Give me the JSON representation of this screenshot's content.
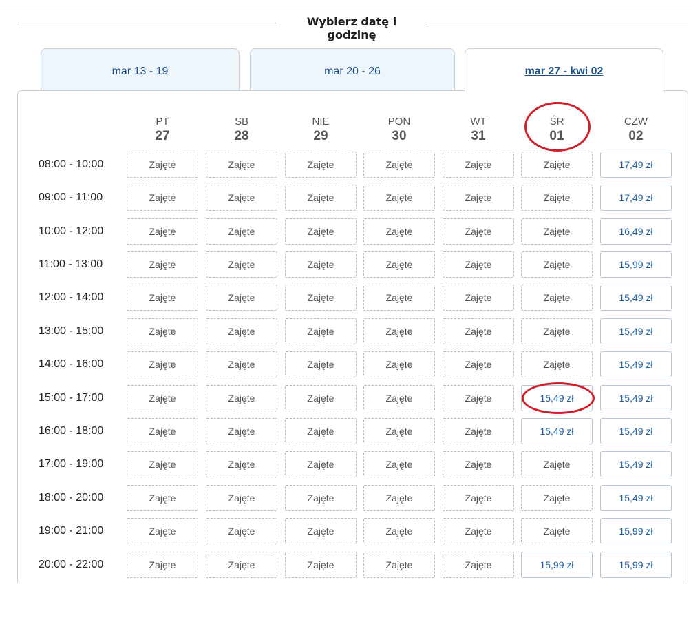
{
  "header": {
    "title": "Wybierz datę i godzinę"
  },
  "tabs": [
    {
      "label": "mar 13 - 19",
      "active": false
    },
    {
      "label": "mar 20 - 26",
      "active": false
    },
    {
      "label": "mar 27 - kwi 02",
      "active": true
    }
  ],
  "days": [
    {
      "name": "PT",
      "num": "27"
    },
    {
      "name": "SB",
      "num": "28"
    },
    {
      "name": "NIE",
      "num": "29"
    },
    {
      "name": "PON",
      "num": "30"
    },
    {
      "name": "WT",
      "num": "31"
    },
    {
      "name": "ŚR",
      "num": "01"
    },
    {
      "name": "CZW",
      "num": "02"
    }
  ],
  "taken_label": "Zajęte",
  "rows": [
    {
      "time": "08:00 - 10:00",
      "cells": [
        "Zajęte",
        "Zajęte",
        "Zajęte",
        "Zajęte",
        "Zajęte",
        "Zajęte",
        "17,49 zł"
      ]
    },
    {
      "time": "09:00 - 11:00",
      "cells": [
        "Zajęte",
        "Zajęte",
        "Zajęte",
        "Zajęte",
        "Zajęte",
        "Zajęte",
        "17,49 zł"
      ]
    },
    {
      "time": "10:00 - 12:00",
      "cells": [
        "Zajęte",
        "Zajęte",
        "Zajęte",
        "Zajęte",
        "Zajęte",
        "Zajęte",
        "16,49 zł"
      ]
    },
    {
      "time": "11:00 - 13:00",
      "cells": [
        "Zajęte",
        "Zajęte",
        "Zajęte",
        "Zajęte",
        "Zajęte",
        "Zajęte",
        "15,99 zł"
      ]
    },
    {
      "time": "12:00 - 14:00",
      "cells": [
        "Zajęte",
        "Zajęte",
        "Zajęte",
        "Zajęte",
        "Zajęte",
        "Zajęte",
        "15,49 zł"
      ]
    },
    {
      "time": "13:00 - 15:00",
      "cells": [
        "Zajęte",
        "Zajęte",
        "Zajęte",
        "Zajęte",
        "Zajęte",
        "Zajęte",
        "15,49 zł"
      ]
    },
    {
      "time": "14:00 - 16:00",
      "cells": [
        "Zajęte",
        "Zajęte",
        "Zajęte",
        "Zajęte",
        "Zajęte",
        "Zajęte",
        "15,49 zł"
      ]
    },
    {
      "time": "15:00 - 17:00",
      "cells": [
        "Zajęte",
        "Zajęte",
        "Zajęte",
        "Zajęte",
        "Zajęte",
        "15,49 zł",
        "15,49 zł"
      ]
    },
    {
      "time": "16:00 - 18:00",
      "cells": [
        "Zajęte",
        "Zajęte",
        "Zajęte",
        "Zajęte",
        "Zajęte",
        "15,49 zł",
        "15,49 zł"
      ]
    },
    {
      "time": "17:00 - 19:00",
      "cells": [
        "Zajęte",
        "Zajęte",
        "Zajęte",
        "Zajęte",
        "Zajęte",
        "Zajęte",
        "15,49 zł"
      ]
    },
    {
      "time": "18:00 - 20:00",
      "cells": [
        "Zajęte",
        "Zajęte",
        "Zajęte",
        "Zajęte",
        "Zajęte",
        "Zajęte",
        "15,49 zł"
      ]
    },
    {
      "time": "19:00 - 21:00",
      "cells": [
        "Zajęte",
        "Zajęte",
        "Zajęte",
        "Zajęte",
        "Zajęte",
        "Zajęte",
        "15,99 zł"
      ]
    },
    {
      "time": "20:00 - 22:00",
      "cells": [
        "Zajęte",
        "Zajęte",
        "Zajęte",
        "Zajęte",
        "Zajęte",
        "15,99 zł",
        "15,99 zł"
      ]
    }
  ],
  "annotations": [
    {
      "target": "day-header",
      "day": "ŚR"
    },
    {
      "target": "cell",
      "day": "ŚR",
      "time": "15:00 - 17:00"
    }
  ],
  "colors": {
    "accent": "#1c5fa3",
    "annotation": "#d11f2a",
    "tab_bg": "#eef5fb"
  }
}
